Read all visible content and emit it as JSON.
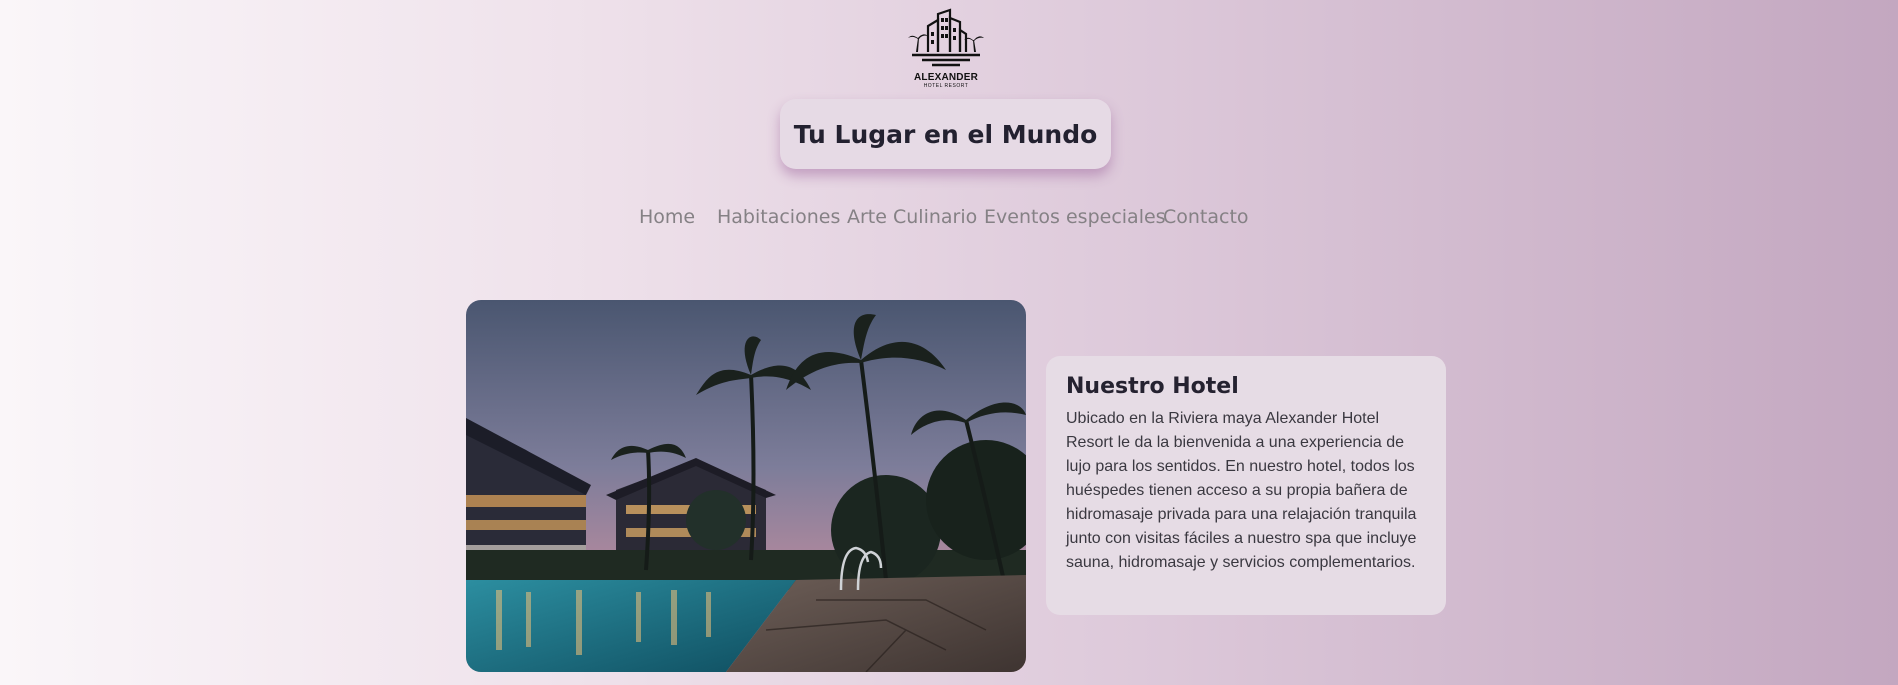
{
  "logo": {
    "name": "ALEXANDER",
    "subtitle": "HOTEL RESORT",
    "icon": "hotel-building-palms-icon"
  },
  "header": {
    "title": "Tu Lugar en el Mundo"
  },
  "nav": {
    "items": [
      {
        "label": "Home"
      },
      {
        "label": "Habitaciones"
      },
      {
        "label": "Arte Culinario"
      },
      {
        "label": "Eventos especiales"
      },
      {
        "label": "Contacto"
      }
    ]
  },
  "main": {
    "image_subject": "hotel-pool-night-photo",
    "section_title": "Nuestro Hotel",
    "section_text": "Ubicado en la Riviera maya Alexander Hotel Resort le da la bienvenida a una experiencia de lujo para los sentidos. En nuestro hotel, todos los huéspedes tienen acceso a su propia bañera de hidromasaje privada para una relajación tranquila junto con visitas fáciles a nuestro spa que incluye sauna, hidromasaje y servicios complementarios."
  },
  "colors": {
    "title_text": "#232130",
    "nav_text": "#858185",
    "card_bg": "#e6dce5",
    "title_shadow": "#9a5a9a"
  }
}
